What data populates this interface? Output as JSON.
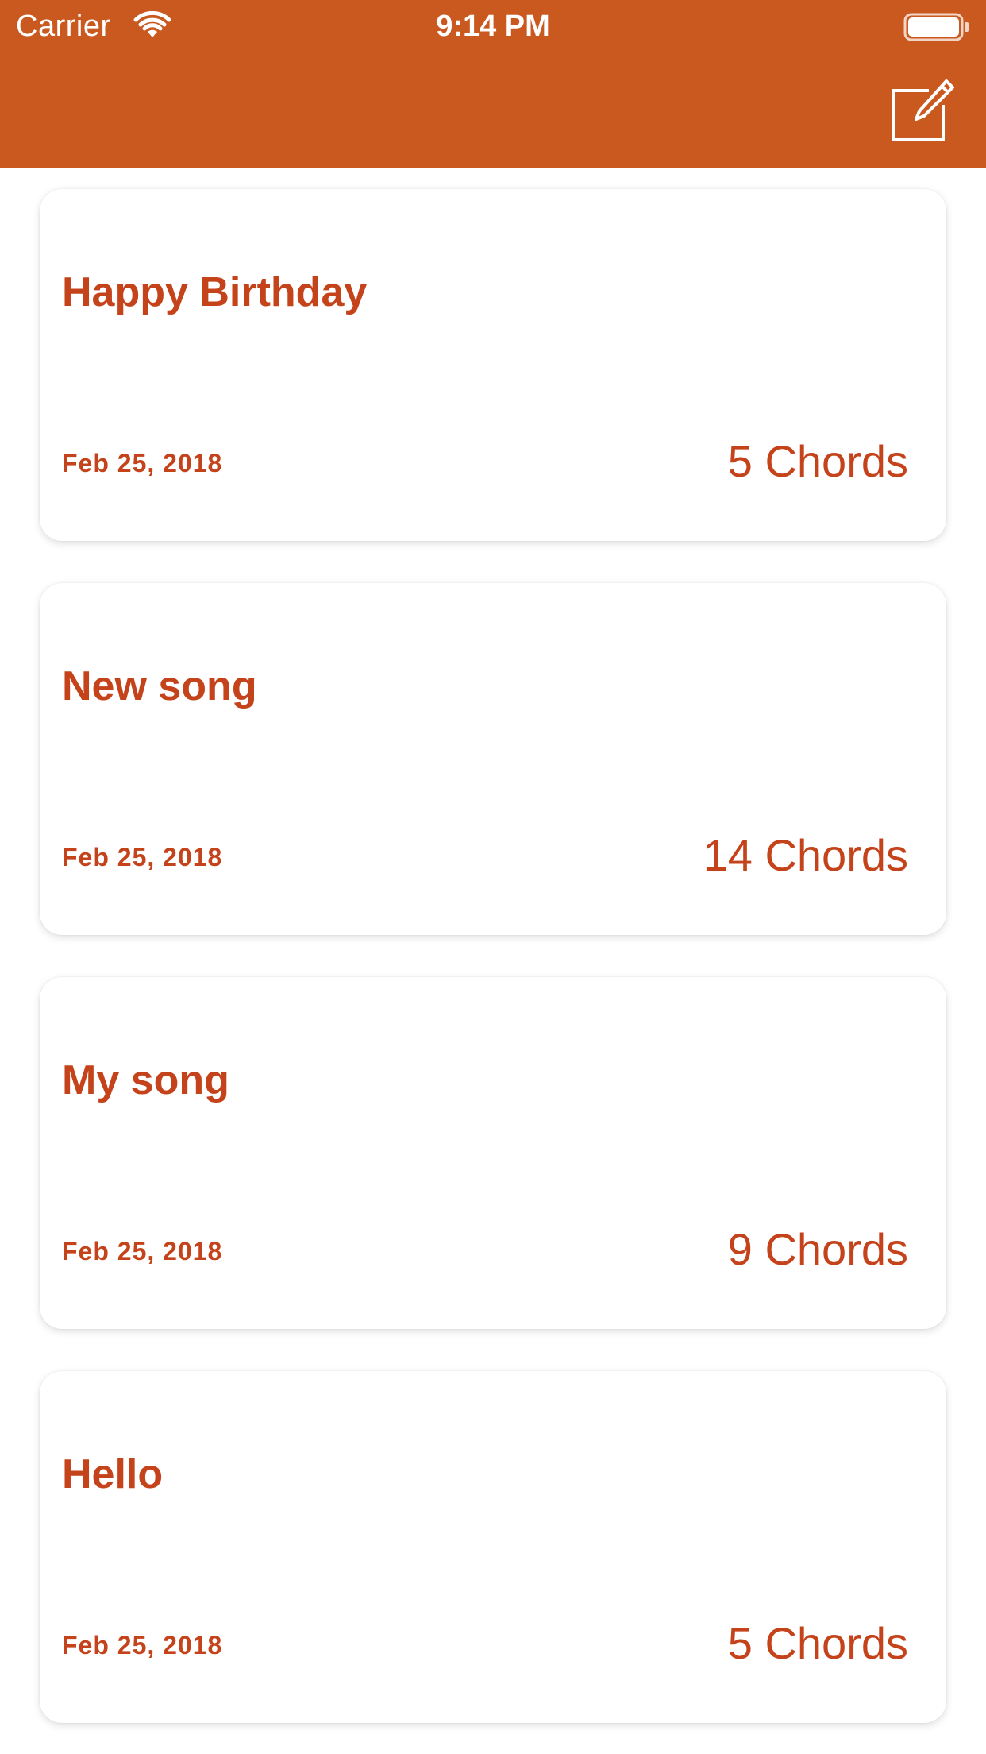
{
  "status_bar": {
    "carrier": "Carrier",
    "time": "9:14 PM"
  },
  "navbar": {
    "background_color": "#c9591e",
    "compose_icon": "compose-icon"
  },
  "songs": [
    {
      "title": "Happy Birthday",
      "date": "Feb 25, 2018",
      "chords": "5 Chords"
    },
    {
      "title": "New song",
      "date": "Feb 25, 2018",
      "chords": "14 Chords"
    },
    {
      "title": "My song",
      "date": "Feb 25, 2018",
      "chords": "9 Chords"
    },
    {
      "title": "Hello",
      "date": "Feb 25, 2018",
      "chords": "5 Chords"
    }
  ],
  "colors": {
    "accent": "#c4431a",
    "card_background": "#ffffff"
  }
}
